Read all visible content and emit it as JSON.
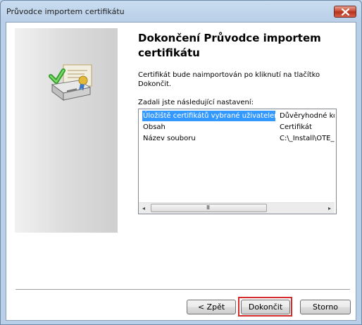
{
  "window": {
    "title": "Průvodce importem certifikátu"
  },
  "heading": "Dokončení Průvodce importem certifikátu",
  "description": "Certifikát bude naimportován po kliknutí na tlačítko Dokončit.",
  "settings_label": "Zadali jste následující nastavení:",
  "settings": [
    {
      "key": "Úložiště certifikátů vybrané uživatelem",
      "value": "Důvěryhodné kořenové",
      "selected": true
    },
    {
      "key": "Obsah",
      "value": "Certifikát",
      "selected": false
    },
    {
      "key": "Název souboru",
      "value": "C:\\_Install\\OTE_",
      "selected": false
    }
  ],
  "scrollbar": {
    "left_arrow": "◂",
    "right_arrow": "▸",
    "grip": "III"
  },
  "buttons": {
    "back": "< Zpět",
    "finish": "Dokončit",
    "cancel": "Storno"
  },
  "highlight_color": "#d62b2b",
  "icons": {
    "close": "close-icon",
    "wizard": "certificate-import-icon"
  }
}
